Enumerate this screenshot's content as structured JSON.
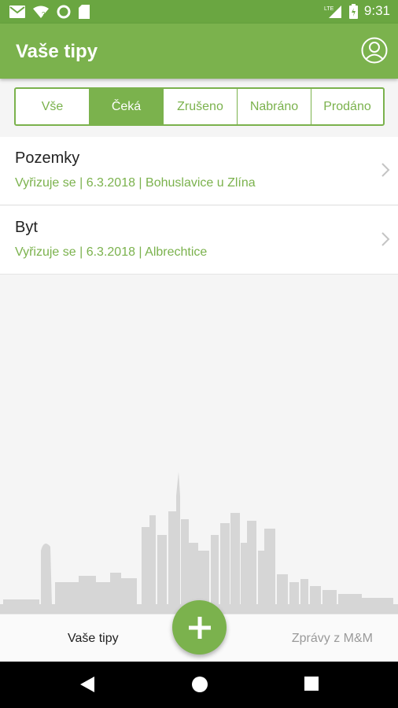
{
  "status_bar": {
    "time": "9:31",
    "network": "LTE",
    "icons": [
      "gmail-icon",
      "wifi-question-icon",
      "sync-icon",
      "sd-card-icon",
      "signal-icon",
      "battery-icon"
    ]
  },
  "app_bar": {
    "title": "Vaše tipy",
    "profile_icon": "account-circle-icon"
  },
  "filter_tabs": [
    {
      "label": "Vše",
      "active": false
    },
    {
      "label": "Čeká",
      "active": true
    },
    {
      "label": "Zrušeno",
      "active": false
    },
    {
      "label": "Nabráno",
      "active": false
    },
    {
      "label": "Prodáno",
      "active": false
    }
  ],
  "tips": [
    {
      "title": "Pozemky",
      "subtitle": "Vyřizuje se | 6.3.2018 | Bohuslavice u Zlína"
    },
    {
      "title": "Byt",
      "subtitle": "Vyřizuje se | 6.3.2018 | Albrechtice"
    }
  ],
  "bottom_nav": {
    "left_label": "Vaše tipy",
    "right_label": "Zprávy z M&M",
    "fab_icon": "plus-icon"
  },
  "system_nav": {
    "icons": [
      "back-icon",
      "home-icon",
      "recents-icon"
    ]
  },
  "colors": {
    "accent": "#7bb24d",
    "status_bar": "#6aa641"
  }
}
